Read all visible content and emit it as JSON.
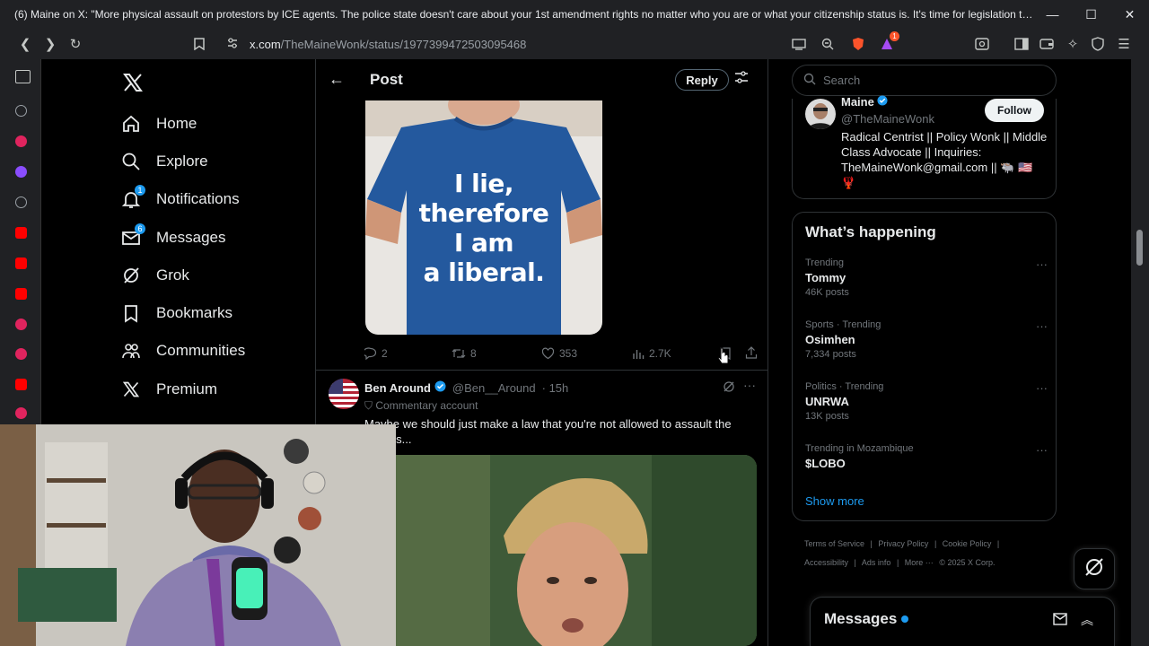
{
  "browser": {
    "tab_title": "(6) Maine on X: \"More physical assault on protestors by ICE agents. The police state doesn't care about your 1st amendment rights no matter who you are or what your citizenship status is. It's time for legislation that creates a...",
    "url_host": "x.com",
    "url_path": "/TheMaineWonk/status/1977399472503095468",
    "window_controls": {
      "minimize": "—",
      "maximize": "☐",
      "close": "✕"
    },
    "extension_badge": "1"
  },
  "nav": {
    "items": [
      {
        "label": "Home",
        "icon": "home-icon"
      },
      {
        "label": "Explore",
        "icon": "search-icon"
      },
      {
        "label": "Notifications",
        "icon": "bell-icon",
        "badge": "1"
      },
      {
        "label": "Messages",
        "icon": "mail-icon",
        "badge": "6"
      },
      {
        "label": "Grok",
        "icon": "grok-icon"
      },
      {
        "label": "Bookmarks",
        "icon": "bookmark-icon"
      },
      {
        "label": "Communities",
        "icon": "communities-icon"
      },
      {
        "label": "Premium",
        "icon": "x-icon"
      }
    ]
  },
  "main": {
    "header": {
      "title": "Post",
      "reply_label": "Reply"
    },
    "post_image_text": [
      "I lie,",
      "therefore",
      "I am",
      "a liberal."
    ],
    "actions": {
      "replies": "2",
      "reposts": "8",
      "likes": "353",
      "views": "2.7K"
    },
    "reply": {
      "name": "Ben Around",
      "handle": "@Ben__Around",
      "time": "· 15h",
      "label": "Commentary account",
      "text": "Maybe we should just make a law that you're not allowed to assault the officers..."
    }
  },
  "right": {
    "search_placeholder": "Search",
    "profile": {
      "name": "Maine",
      "handle": "@TheMaineWonk",
      "follow_label": "Follow",
      "bio": "Radical Centrist || Policy Wonk || Middle Class Advocate || Inquiries: TheMaineWonk@gmail.com || 🐃 🇺🇸 🦞"
    },
    "trends_title": "What’s happening",
    "trends": [
      {
        "category": "Trending",
        "name": "Tommy",
        "count": "46K posts"
      },
      {
        "category": "Sports · Trending",
        "name": "Osimhen",
        "count": "7,334 posts"
      },
      {
        "category": "Politics · Trending",
        "name": "UNRWA",
        "count": "13K posts"
      },
      {
        "category": "Trending in Mozambique",
        "name": "$LOBO",
        "count": ""
      }
    ],
    "show_more": "Show more",
    "footer_links": [
      "Terms of Service",
      "|",
      "Privacy Policy",
      "|",
      "Cookie Policy",
      "|",
      "Accessibility",
      "|",
      "Ads info",
      "|",
      "More ···",
      "© 2025 X Corp."
    ],
    "messages_title": "Messages"
  },
  "colors": {
    "accent": "#1d9bf0",
    "background": "#000000",
    "border": "#2f3336",
    "muted": "#71767b"
  }
}
